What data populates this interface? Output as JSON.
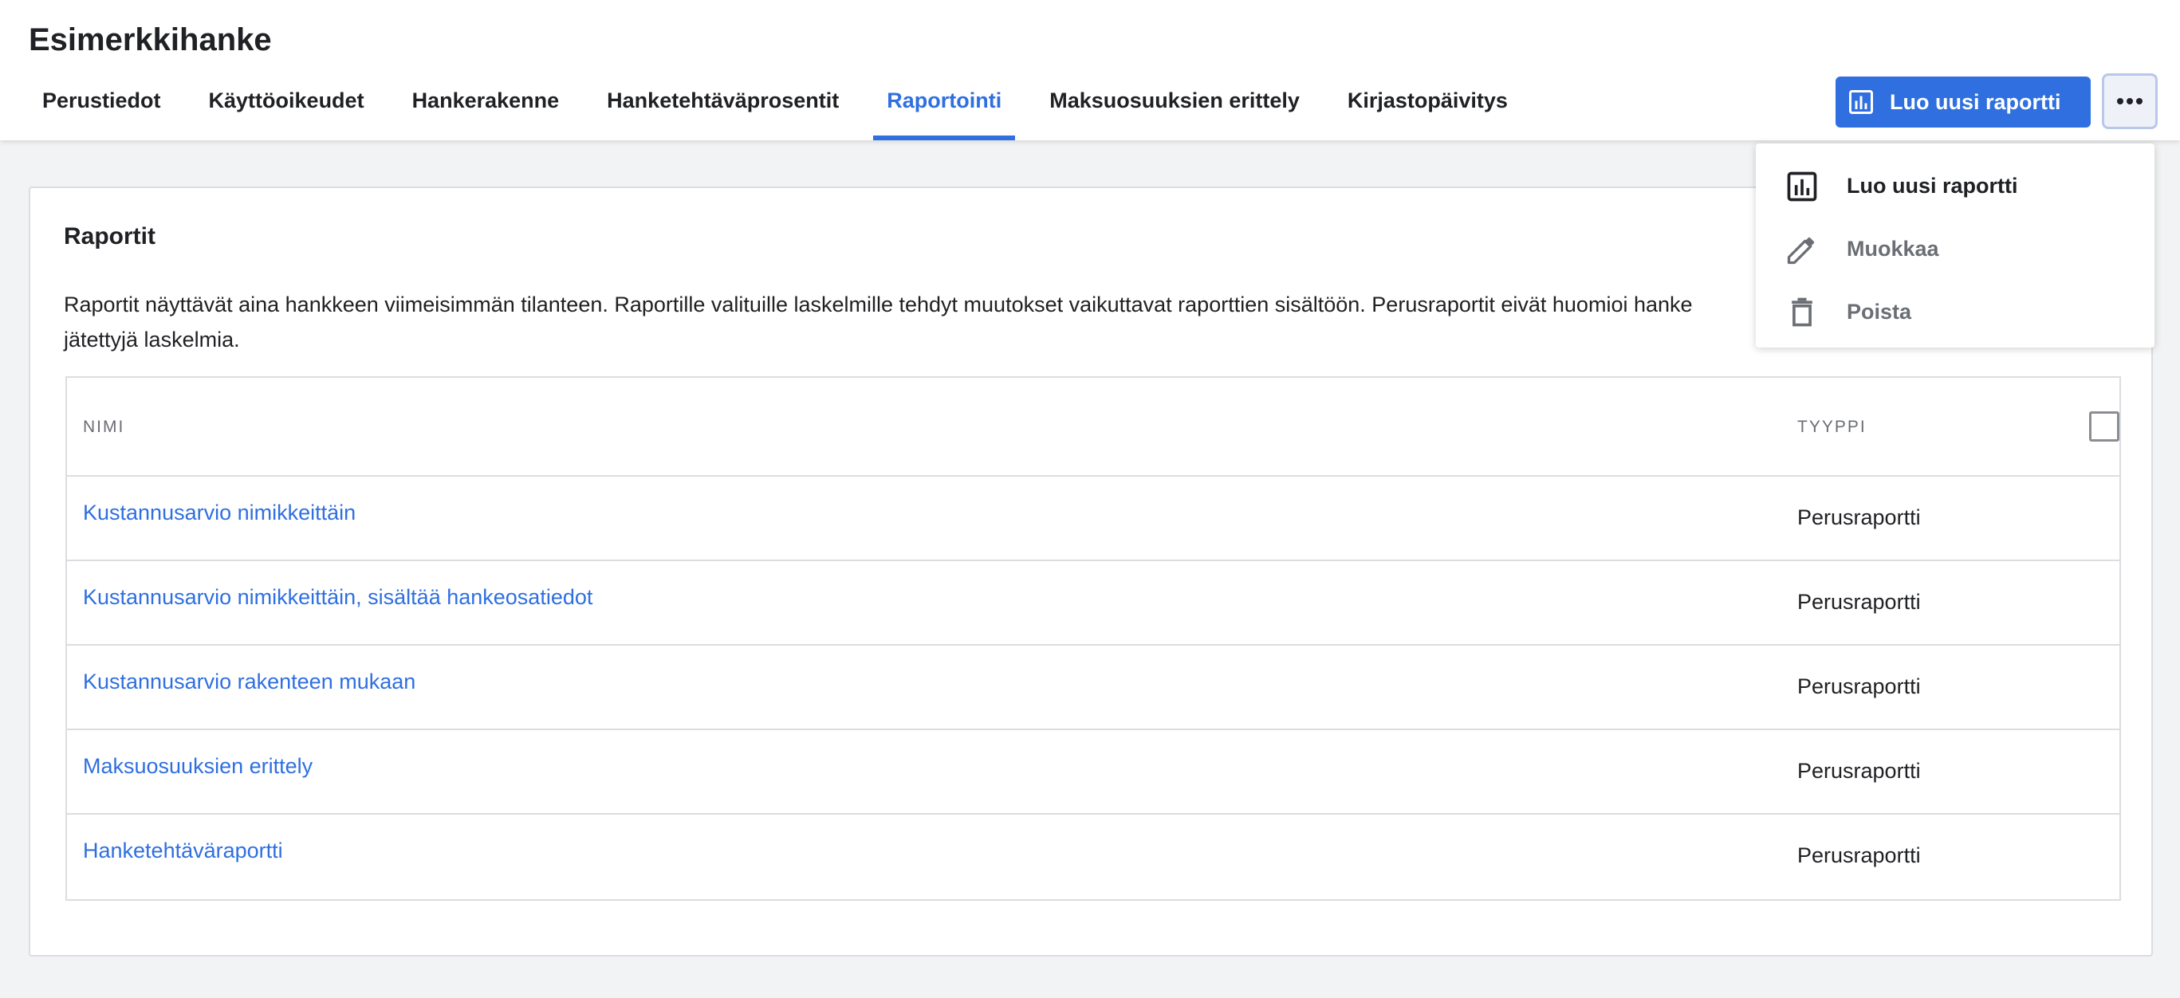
{
  "header": {
    "project_title": "Esimerkkihanke",
    "tabs": [
      {
        "label": "Perustiedot",
        "active": false
      },
      {
        "label": "Käyttöoikeudet",
        "active": false
      },
      {
        "label": "Hankerakenne",
        "active": false
      },
      {
        "label": "Hanketehtäväprosentit",
        "active": false
      },
      {
        "label": "Raportointi",
        "active": true
      },
      {
        "label": "Maksuosuuksien erittely",
        "active": false
      },
      {
        "label": "Kirjastopäivitys",
        "active": false
      }
    ],
    "create_button": {
      "label": "Luo uusi raportti",
      "icon": "bar-chart-icon"
    },
    "more_button": {
      "icon": "more-horizontal-icon"
    }
  },
  "menu": {
    "items": [
      {
        "label": "Luo uusi raportti",
        "icon": "bar-chart-icon",
        "enabled": true
      },
      {
        "label": "Muokkaa",
        "icon": "pencil-icon",
        "enabled": false
      },
      {
        "label": "Poista",
        "icon": "trash-icon",
        "enabled": false
      }
    ]
  },
  "card": {
    "title": "Raportit",
    "description_line1": "Raportit näyttävät aina hankkeen viimeisimmän tilanteen. Raportille valituille laskelmille tehdyt muutokset vaikuttavat raporttien sisältöön. Perusraportit eivät huomioi hanke",
    "description_line2": "jätettyjä laskelmia."
  },
  "table": {
    "columns": {
      "name": "NIMI",
      "type": "TYYPPI"
    },
    "rows": [
      {
        "name": "Kustannusarvio nimikkeittäin",
        "type": "Perusraportti"
      },
      {
        "name": "Kustannusarvio nimikkeittäin, sisältää hankeosatiedot",
        "type": "Perusraportti"
      },
      {
        "name": "Kustannusarvio rakenteen mukaan",
        "type": "Perusraportti"
      },
      {
        "name": "Maksuosuuksien erittely",
        "type": "Perusraportti"
      },
      {
        "name": "Hanketehtäväraportti",
        "type": "Perusraportti"
      }
    ]
  },
  "colors": {
    "accent": "#2f6fe0",
    "background": "#f2f3f5",
    "text": "#202124",
    "muted": "#6b6e74"
  }
}
